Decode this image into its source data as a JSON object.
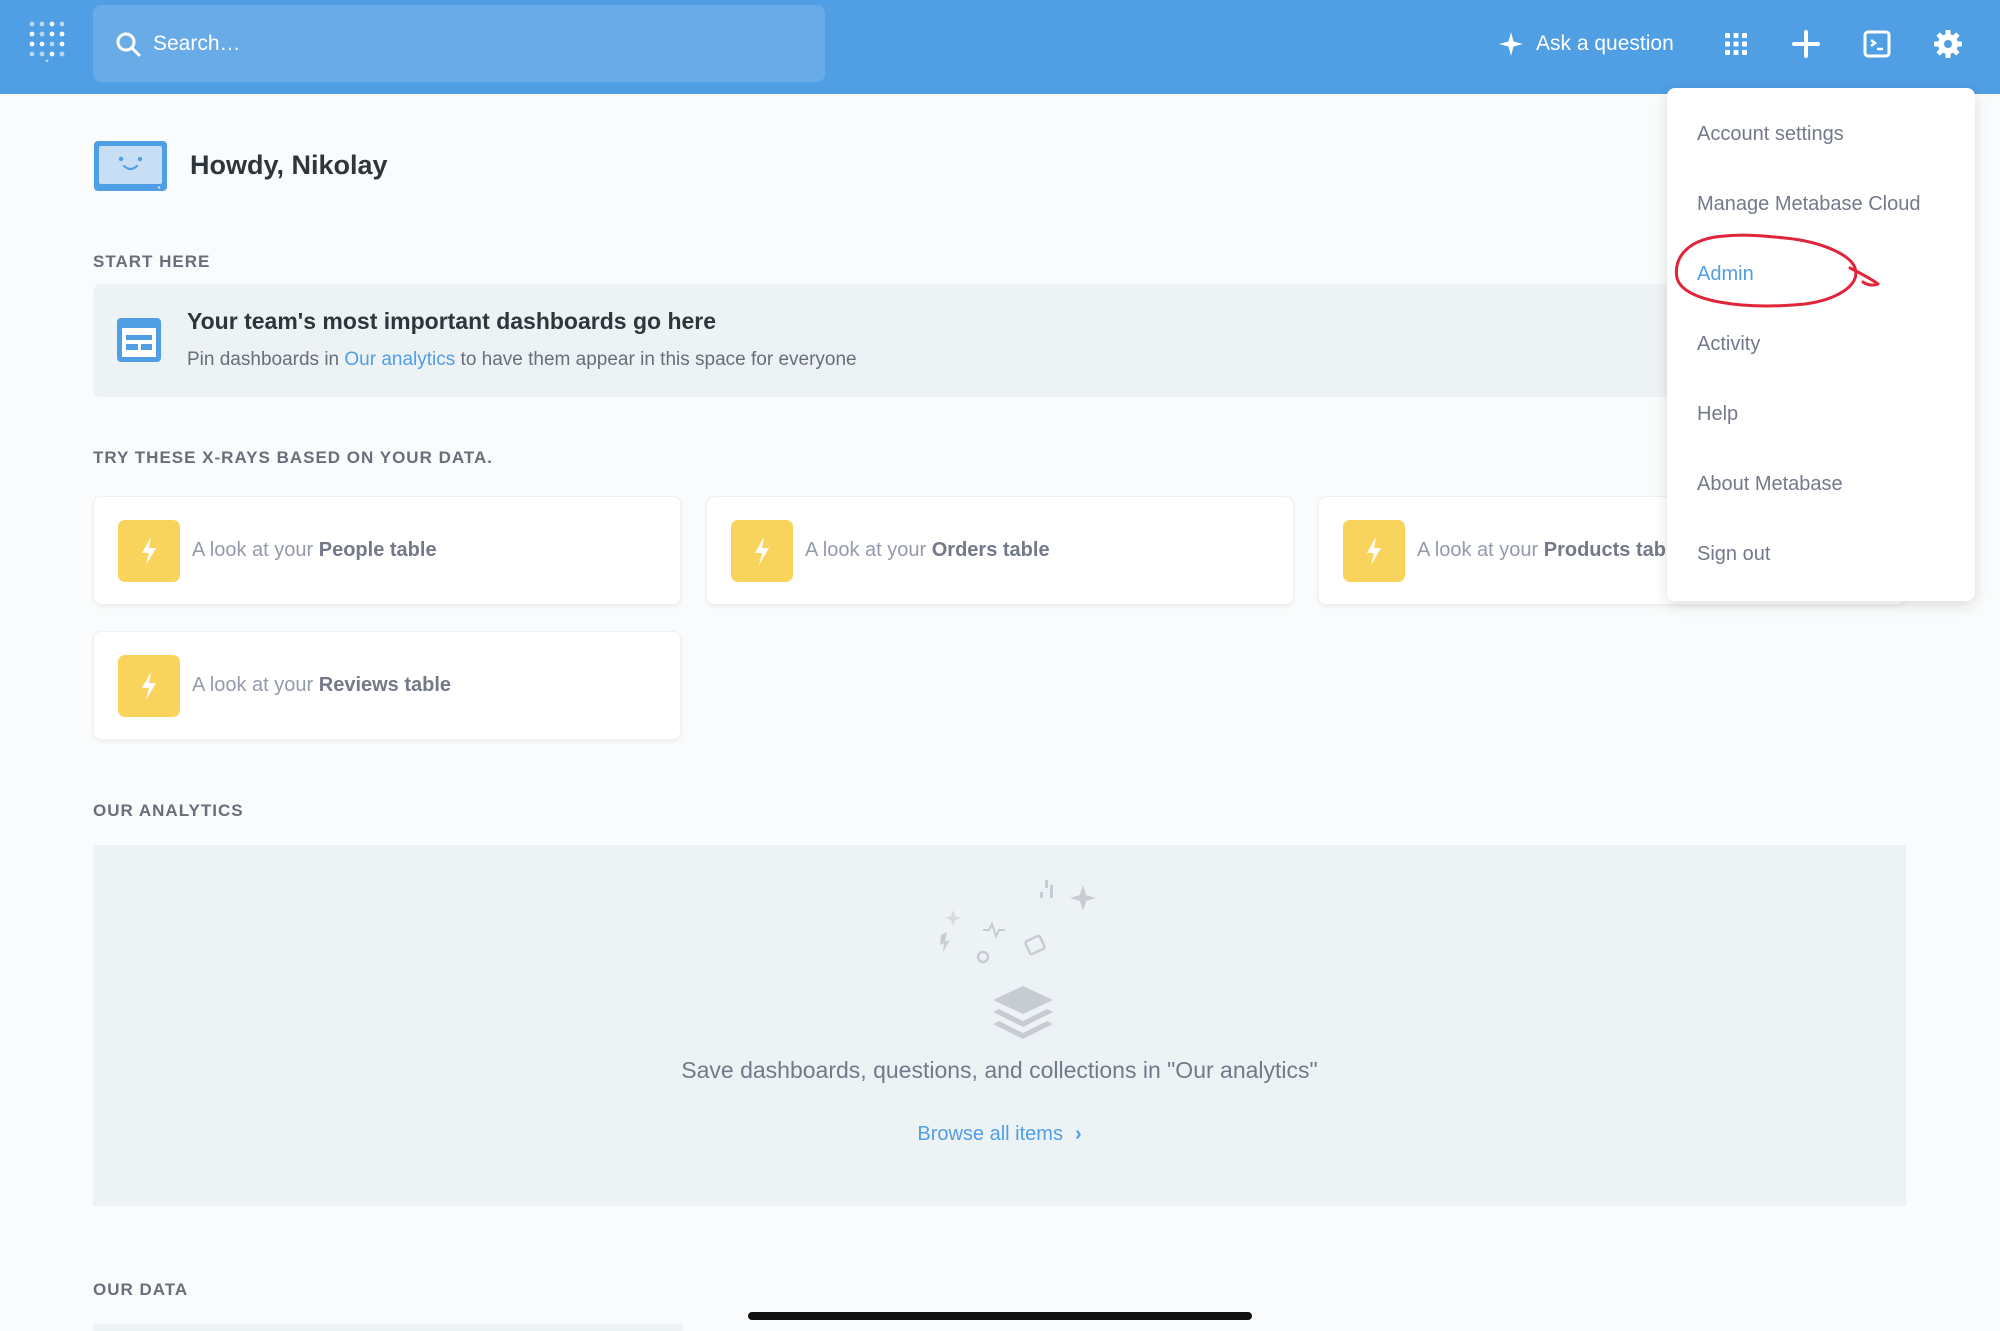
{
  "header": {
    "search_placeholder": "Search…",
    "ask_label": "Ask a question"
  },
  "greeting": "Howdy, Nikolay",
  "start_here": {
    "label": "START HERE",
    "title": "Your team's most important dashboards go here",
    "sub_prefix": "Pin dashboards in ",
    "sub_link": "Our analytics",
    "sub_suffix": " to have them appear in this space for everyone"
  },
  "xrays": {
    "label": "TRY THESE X-RAYS BASED ON YOUR DATA.",
    "prefix": "A look at your ",
    "cards": [
      {
        "table": "People table"
      },
      {
        "table": "Orders table"
      },
      {
        "table": "Products table"
      },
      {
        "table": "Reviews table"
      }
    ]
  },
  "our_analytics": {
    "label": "OUR ANALYTICS",
    "empty_message": "Save dashboards, questions, and collections in \"Our analytics\"",
    "browse_label": "Browse all items"
  },
  "our_data": {
    "label": "OUR DATA"
  },
  "menu": {
    "items": [
      "Account settings",
      "Manage Metabase Cloud",
      "Admin",
      "Activity",
      "Help",
      "About Metabase",
      "Sign out"
    ],
    "highlighted": "Admin"
  },
  "colors": {
    "brand": "#509ee3",
    "xray_yellow": "#f9d45c",
    "annotation_red": "#e0243a"
  }
}
